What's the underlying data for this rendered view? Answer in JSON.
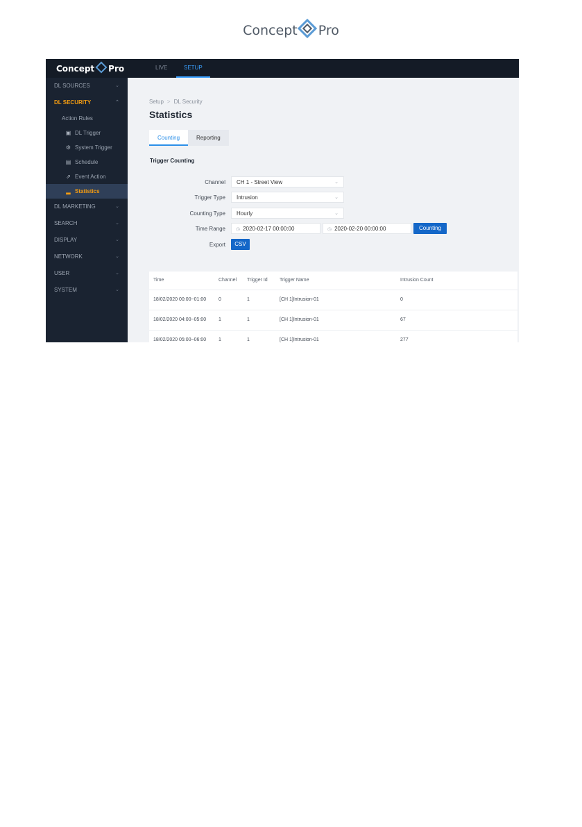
{
  "doc_logo": {
    "left": "Concept",
    "right": "Pro"
  },
  "app": {
    "brand_left": "Concept",
    "brand_right": "Pro",
    "top_tabs": [
      "LIVE",
      "SETUP"
    ]
  },
  "sidebar": {
    "items": [
      {
        "label": "DL SOURCES"
      },
      {
        "label": "DL SECURITY"
      },
      {
        "label": "DL MARKETING"
      },
      {
        "label": "SEARCH"
      },
      {
        "label": "DISPLAY"
      },
      {
        "label": "NETWORK"
      },
      {
        "label": "USER"
      },
      {
        "label": "SYSTEM"
      }
    ],
    "action_rules": "Action Rules",
    "sub_items": [
      {
        "label": "DL Trigger",
        "icon": "dl-trigger-icon"
      },
      {
        "label": "System Trigger",
        "icon": "system-trigger-icon"
      },
      {
        "label": "Schedule",
        "icon": "schedule-icon"
      },
      {
        "label": "Event Action",
        "icon": "event-action-icon"
      },
      {
        "label": "Statistics",
        "icon": "statistics-icon"
      }
    ]
  },
  "breadcrumb": {
    "root": "Setup",
    "current": "DL Security"
  },
  "page_title": "Statistics",
  "tabs": [
    "Counting",
    "Reporting"
  ],
  "section_title": "Trigger Counting",
  "form": {
    "channel_label": "Channel",
    "channel_value": "CH 1 - Street View",
    "trigger_type_label": "Trigger Type",
    "trigger_type_value": "Intrusion",
    "counting_type_label": "Counting Type",
    "counting_type_value": "Hourly",
    "time_range_label": "Time Range",
    "time_start": "2020-02-17 00:00:00",
    "time_end": "2020-02-20 00:00:00",
    "counting_button": "Counting",
    "export_label": "Export",
    "csv_button": "CSV"
  },
  "table": {
    "columns": [
      "Time",
      "Channel",
      "Trigger Id",
      "Trigger Name",
      "Intrusion Count"
    ],
    "rows": [
      [
        "18/02/2020 00:00~01:00",
        "0",
        "1",
        "[CH 1]Intrusion-01",
        "0"
      ],
      [
        "18/02/2020 04:00~05:00",
        "1",
        "1",
        "[CH 1]Intrusion-01",
        "67"
      ],
      [
        "18/02/2020 05:00~06:00",
        "1",
        "1",
        "[CH 1]Intrusion-01",
        "277"
      ]
    ]
  },
  "colors": {
    "accent": "#1467c8",
    "active_nav": "#f39c12",
    "sidebar_bg": "#1a2331"
  }
}
